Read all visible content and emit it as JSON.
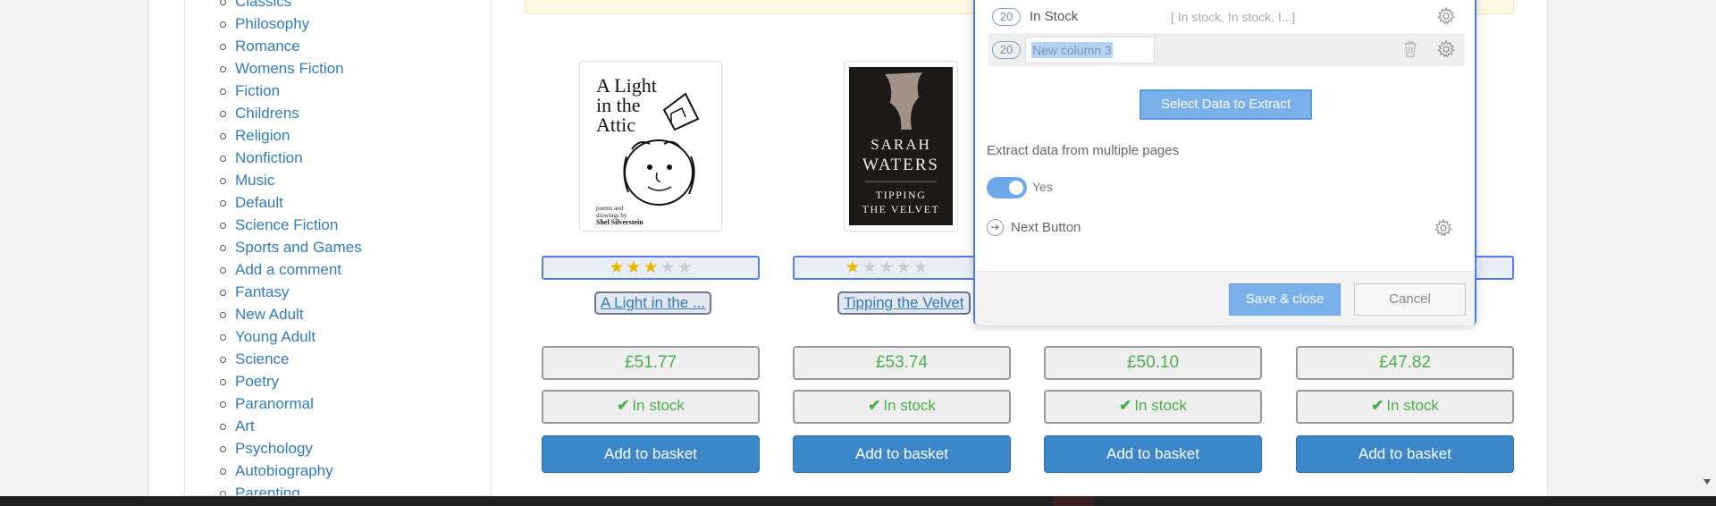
{
  "sidebar": {
    "categories": [
      "Classics",
      "Philosophy",
      "Romance",
      "Womens Fiction",
      "Fiction",
      "Childrens",
      "Religion",
      "Nonfiction",
      "Music",
      "Default",
      "Science Fiction",
      "Sports and Games",
      "Add a comment",
      "Fantasy",
      "New Adult",
      "Young Adult",
      "Science",
      "Poetry",
      "Paranormal",
      "Art",
      "Psychology",
      "Autobiography",
      "Parenting"
    ]
  },
  "books": [
    {
      "cover": {
        "title_lines": [
          "A Light",
          "in the",
          "Attic"
        ],
        "byline": [
          "poems and",
          "drawings by",
          "Shel Silverstein"
        ]
      },
      "stars": 3,
      "title": "A Light in the ...",
      "price": "£51.77",
      "availability": "In stock",
      "button": "Add to basket"
    },
    {
      "cover": {
        "author_lines": [
          "SARAH",
          "WATERS"
        ],
        "title_lines": [
          "TIPPING",
          "THE VELVET"
        ]
      },
      "stars": 1,
      "title": "Tipping the Velvet",
      "price": "£53.74",
      "availability": "In stock",
      "button": "Add to basket"
    },
    {
      "price": "£50.10",
      "availability": "In stock",
      "button": "Add to basket"
    },
    {
      "price": "£47.82",
      "availability": "In stock",
      "button": "Add to basket"
    }
  ],
  "modal": {
    "columns": [
      {
        "count": "20",
        "name": "In Stock",
        "preview": "[ In stock,  In stock,  I...]"
      },
      {
        "count": "20",
        "name": "New column 3",
        "editing": true
      }
    ],
    "select_button": "Select Data to Extract",
    "multi_page_label": "Extract data from multiple pages",
    "toggle_label": "Yes",
    "next_button_label": "Next Button",
    "save_button": "Save & close",
    "cancel_button": "Cancel"
  },
  "colors": {
    "link": "#337ab7",
    "price_green": "#4cae4c",
    "button_blue": "#3b87c9",
    "star_gold": "#e8b800",
    "modal_accent": "#4a7de0"
  }
}
